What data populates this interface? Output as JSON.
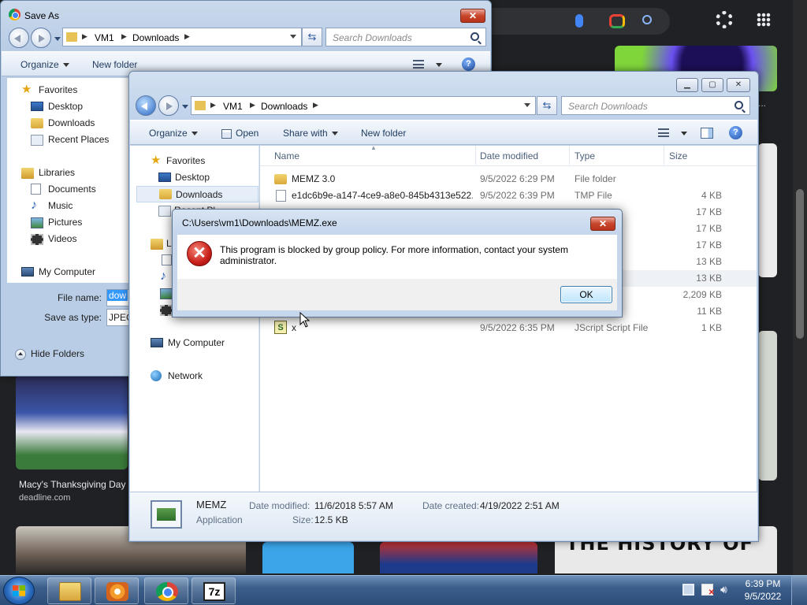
{
  "browser": {
    "results": [
      {
        "caption": "Macy's Thanksgiving Day",
        "source": "deadline.com"
      },
      {
        "caption": "THE HISTORY OF"
      }
    ],
    "snippet_fragment": "et..."
  },
  "save_as": {
    "title": "Save As",
    "breadcrumb": [
      "VM1",
      "Downloads"
    ],
    "search_placeholder": "Search Downloads",
    "toolbar": {
      "organize": "Organize",
      "new_folder": "New folder"
    },
    "nav": [
      {
        "label": "Favorites",
        "icon": "star-icon"
      },
      {
        "label": "Desktop",
        "icon": "desktop-icon"
      },
      {
        "label": "Downloads",
        "icon": "folder-icon"
      },
      {
        "label": "Recent Places",
        "icon": "recent-places-icon"
      },
      {
        "label": "Libraries",
        "icon": "library-icon"
      },
      {
        "label": "Documents",
        "icon": "documents-icon"
      },
      {
        "label": "Music",
        "icon": "music-icon"
      },
      {
        "label": "Pictures",
        "icon": "pictures-icon"
      },
      {
        "label": "Videos",
        "icon": "videos-icon"
      },
      {
        "label": "My Computer",
        "icon": "computer-icon"
      }
    ],
    "file_name_label": "File name:",
    "file_name_value": "dow",
    "save_type_label": "Save as type:",
    "save_type_value": "JPEG",
    "hide_folders": "Hide Folders"
  },
  "explorer": {
    "breadcrumb": [
      "VM1",
      "Downloads"
    ],
    "search_placeholder": "Search Downloads",
    "toolbar": {
      "organize": "Organize",
      "open": "Open",
      "share_with": "Share with",
      "new_folder": "New folder"
    },
    "nav": [
      {
        "label": "Favorites",
        "icon": "star-icon"
      },
      {
        "label": "Desktop",
        "icon": "desktop-icon"
      },
      {
        "label": "Downloads",
        "icon": "folder-icon",
        "selected": true
      },
      {
        "label": "My Computer",
        "icon": "computer-icon"
      },
      {
        "label": "Network",
        "icon": "network-icon"
      }
    ],
    "nav_partial": [
      "Recent Pl",
      "L"
    ],
    "columns": {
      "name": "Name",
      "date": "Date modified",
      "type": "Type",
      "size": "Size"
    },
    "files": [
      {
        "name": "MEMZ 3.0",
        "date": "9/5/2022 6:29 PM",
        "type": "File folder",
        "size": "",
        "icon": "folder"
      },
      {
        "name": "e1dc6b9e-a147-4ce9-a8e0-845b4313e522...",
        "date": "9/5/2022 6:39 PM",
        "type": "TMP File",
        "size": "4 KB",
        "icon": "file"
      },
      {
        "name": "",
        "date": "",
        "type": "",
        "size": "17 KB",
        "icon": ""
      },
      {
        "name": "",
        "date": "",
        "type": "",
        "size": "17 KB",
        "icon": ""
      },
      {
        "name": "",
        "date": "",
        "type": "",
        "size": "17 KB",
        "icon": ""
      },
      {
        "name": "",
        "date": "",
        "type": "atch File",
        "size": "13 KB",
        "icon": ""
      },
      {
        "name": "",
        "date": "",
        "type": "",
        "size": "13 KB",
        "icon": "",
        "highlight": true
      },
      {
        "name": "",
        "date": "",
        "type": "",
        "size": "2,209 KB",
        "icon": ""
      },
      {
        "name": "",
        "date": "",
        "type": "",
        "size": "11 KB",
        "icon": ""
      },
      {
        "name": "x",
        "date": "9/5/2022 6:35 PM",
        "type": "JScript Script File",
        "size": "1 KB",
        "icon": "script"
      }
    ],
    "details": {
      "name": "MEMZ",
      "type": "Application",
      "modified_label": "Date modified:",
      "modified": "11/6/2018 5:57 AM",
      "created_label": "Date created:",
      "created": "4/19/2022 2:51 AM",
      "size_label": "Size:",
      "size": "12.5 KB"
    }
  },
  "dialog": {
    "title": "C:\\Users\\vm1\\Downloads\\MEMZ.exe",
    "message": "This program is blocked by group policy. For more information, contact your system administrator.",
    "ok": "OK",
    "close": "✕"
  },
  "taskbar": {
    "pinned": [
      "windows-explorer",
      "media-player",
      "chrome",
      "7-zip"
    ],
    "sevenzip_label": "7z",
    "time": "6:39 PM",
    "date": "9/5/2022"
  },
  "colors": {
    "accent": "#3c5e8b",
    "error": "#c8201a",
    "selection": "#3399ff"
  }
}
